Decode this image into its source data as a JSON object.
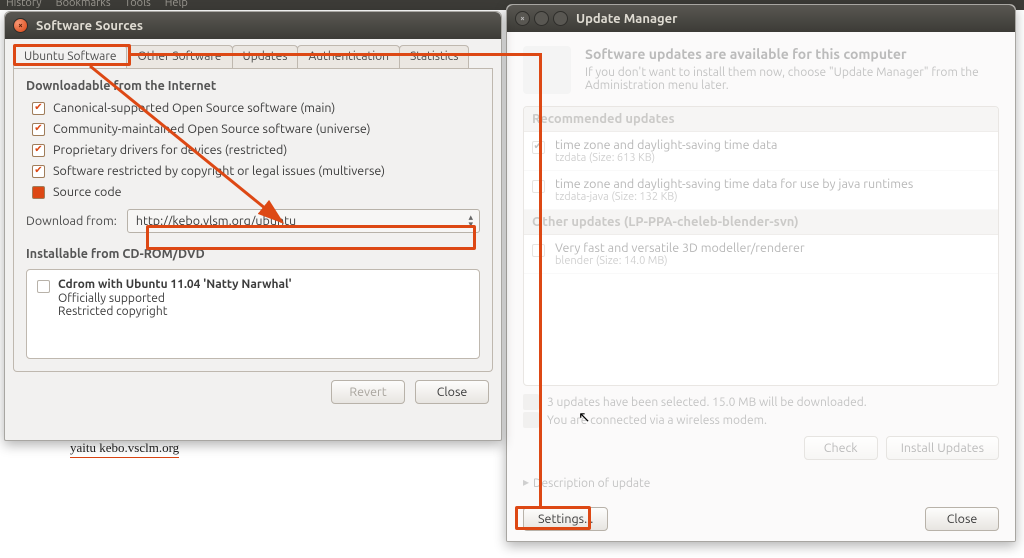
{
  "menubar": [
    "History",
    "Bookmarks",
    "Tools",
    "Help"
  ],
  "ss": {
    "title": "Software Sources",
    "tabs": [
      "Ubuntu Software",
      "Other Software",
      "Updates",
      "Authentication",
      "Statistics"
    ],
    "section1": "Downloadable from the Internet",
    "checks": [
      {
        "label": "Canonical-supported Open Source software (main)",
        "on": true
      },
      {
        "label": "Community-maintained Open Source software (universe)",
        "on": true
      },
      {
        "label": "Proprietary drivers for devices (restricted)",
        "on": true
      },
      {
        "label": "Software restricted by copyright or legal issues (multiverse)",
        "on": true
      },
      {
        "label": "Source code",
        "half": true
      }
    ],
    "download_label": "Download from:",
    "download_value": "http://kebo.vlsm.org/ubuntu",
    "section2": "Installable from CD-ROM/DVD",
    "cd": {
      "title": "Cdrom with Ubuntu 11.04 'Natty Narwhal'",
      "l1": "Officially supported",
      "l2": "Restricted copyright"
    },
    "revert": "Revert",
    "close": "Close"
  },
  "um": {
    "title": "Update Manager",
    "head": "Software updates are available for this computer",
    "sub": "If you don't want to install them now, choose \"Update Manager\" from the Administration menu later.",
    "grp1": "Recommended updates",
    "items1": [
      {
        "t": "time zone and daylight-saving time data",
        "s": "tzdata (Size: 613 KB)",
        "on": true
      },
      {
        "t": "time zone and daylight-saving time data for use by java runtimes",
        "s": "tzdata-java (Size: 132 KB)",
        "on": false
      }
    ],
    "grp2": "Other updates (LP-PPA-cheleb-blender-svn)",
    "items2": [
      {
        "t": "Very fast and versatile 3D modeller/renderer",
        "s": "blender (Size: 14.0 MB)",
        "on": false
      }
    ],
    "status1": "3 updates have been selected. 15.0 MB will be downloaded.",
    "status2": "You are connected via a wireless modem.",
    "check": "Check",
    "install": "Install Updates",
    "desc": "Description of update",
    "settings": "Settings...",
    "close": "Close"
  },
  "caption": "yaitu kebo.vsclm.org"
}
